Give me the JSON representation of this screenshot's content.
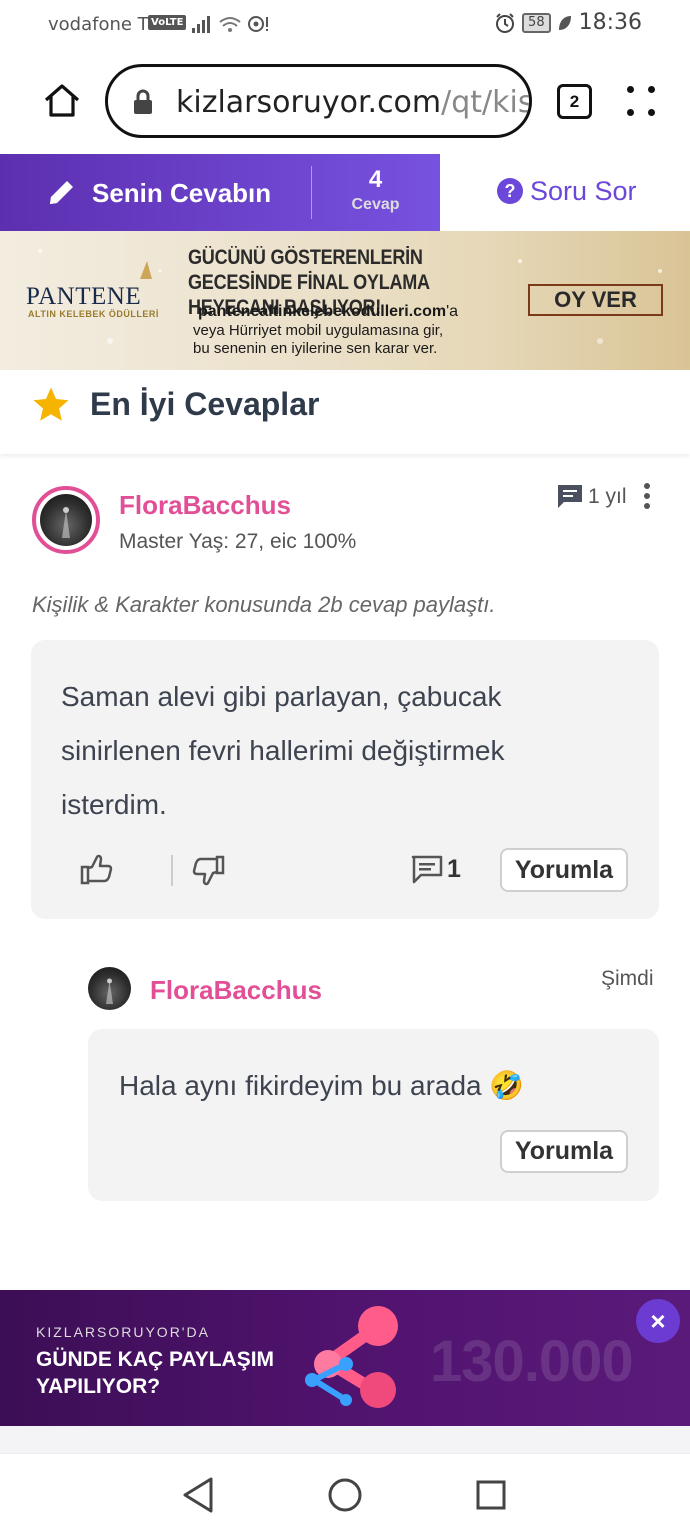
{
  "status_bar": {
    "carrier": "vodafone TR",
    "volte": "VoLTE",
    "battery": "58",
    "time": "18:36"
  },
  "browser": {
    "url_domain": "kizlarsoruyor.com",
    "url_path": "/qt/kisil",
    "tab_count": "2"
  },
  "tabs": {
    "answer_label": "Senin Cevabın",
    "answer_count": "4",
    "answer_count_label": "Cevap",
    "ask_label": "Soru Sor"
  },
  "ad": {
    "brand": "PANTENE",
    "brand_sub": "ALTIN KELEBEK ÖDÜLLERİ",
    "headline": "GÜCÜNÜ GÖSTERENLERİN GECESİNDE FİNAL OYLAMA HEYECANI BAŞLIYOR!",
    "domain": "pantenealtinkelebekodulleri.com",
    "domain_suffix": "'a",
    "body_line1": "veya Hürriyet mobil uygulamasına gir,",
    "body_line2": "bu senenin en iyilerine sen karar ver.",
    "cta": "OY VER"
  },
  "section": {
    "title": "En İyi Cevaplar"
  },
  "answer": {
    "username": "FloraBacchus",
    "meta": "Master Yaş: 27, eic 100%",
    "time": "1 yıl",
    "topic": "Kişilik & Karakter konusunda 2b cevap paylaştı.",
    "text_line1": "Saman alevi gibi parlayan, çabucak",
    "text_line2": "sinirlenen fevri hallerimi değiştirmek",
    "text_line3": "isterdim.",
    "comment_count": "1",
    "comment_button": "Yorumla"
  },
  "reply": {
    "username": "FloraBacchus",
    "time": "Şimdi",
    "text": "Hala aynı fikirdeyim bu arada 🤣",
    "comment_button": "Yorumla"
  },
  "promo": {
    "small": "KIZLARSORUYOR'DA",
    "line1": "GÜNDE KAÇ PAYLAŞIM",
    "line2": "YAPILIYOR?",
    "number": "130.000",
    "close": "×"
  },
  "colors": {
    "accent_purple": "#6b48d9",
    "username_pink": "#e24f96",
    "promo_bg": "#4a1166"
  }
}
